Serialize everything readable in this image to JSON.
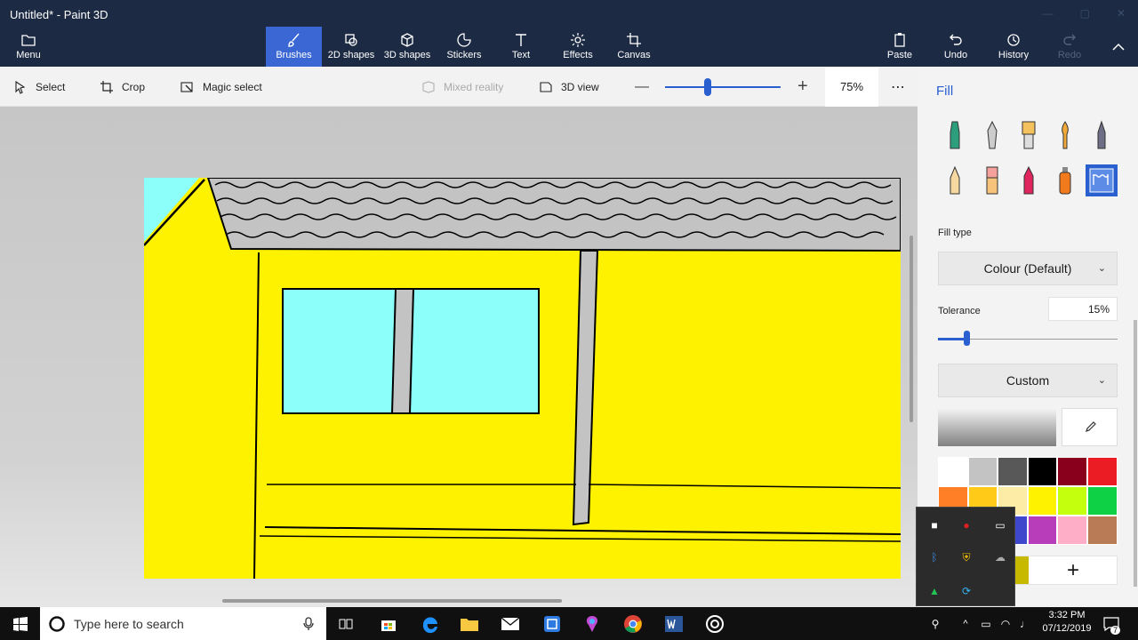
{
  "window": {
    "title": "Untitled* - Paint 3D"
  },
  "ribbon": {
    "menu": "Menu",
    "tabs": [
      {
        "label": "Brushes",
        "icon": "brush-icon",
        "active": true
      },
      {
        "label": "2D shapes",
        "icon": "2d-shapes-icon"
      },
      {
        "label": "3D shapes",
        "icon": "cube-icon"
      },
      {
        "label": "Stickers",
        "icon": "sticker-icon"
      },
      {
        "label": "Text",
        "icon": "text-icon"
      },
      {
        "label": "Effects",
        "icon": "effects-icon"
      },
      {
        "label": "Canvas",
        "icon": "canvas-icon"
      }
    ],
    "actions": [
      {
        "label": "Paste",
        "icon": "paste-icon"
      },
      {
        "label": "Undo",
        "icon": "undo-icon"
      },
      {
        "label": "History",
        "icon": "history-icon"
      },
      {
        "label": "Redo",
        "icon": "redo-icon",
        "disabled": true
      }
    ]
  },
  "toolbar": {
    "select": "Select",
    "crop": "Crop",
    "magic_select": "Magic select",
    "mixed_reality": "Mixed reality",
    "view_3d": "3D view",
    "zoom": "75%",
    "zoom_level": 0.35,
    "more": "⋯"
  },
  "panel": {
    "title": "Fill",
    "fill_type_label": "Fill type",
    "fill_type_value": "Colour (Default)",
    "tolerance_label": "Tolerance",
    "tolerance_value": "15%",
    "tolerance_level": 0.15,
    "custom_label": "Custom",
    "add_button": "+",
    "palette": [
      "#ffffff",
      "#c3c3c3",
      "#585858",
      "#000000",
      "#88001b",
      "#ec1c24",
      "#ff7f27",
      "#ffca18",
      "#fdeca6",
      "#fff200",
      "#c4ff0e",
      "#0ed145",
      "#8cfffb",
      "#00a8f3",
      "#3f48cc",
      "#b83dba",
      "#ffaec8",
      "#b97a56"
    ]
  },
  "taskbar": {
    "search_placeholder": "Type here to search",
    "time": "3:32 PM",
    "date": "07/12/2019",
    "notification_count": "7"
  },
  "colors": {
    "accent": "#2a5fd0",
    "wall_yellow": "#fff200",
    "window_cyan": "#8cfffb",
    "roof_grey": "#c3c3c3"
  }
}
